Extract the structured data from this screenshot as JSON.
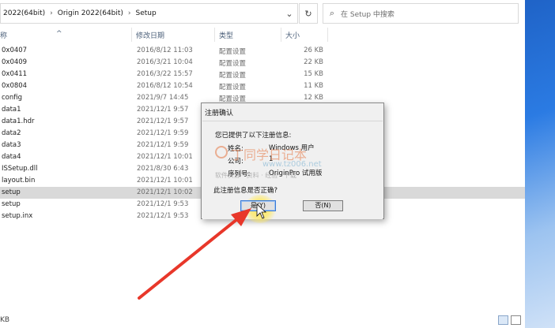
{
  "breadcrumb": [
    "2022(64bit)",
    "Origin 2022(64bit)",
    "Setup"
  ],
  "search": {
    "placeholder": "在 Setup 中搜索"
  },
  "columns": {
    "name": "称",
    "modified": "修改日期",
    "type": "类型",
    "size": "大小"
  },
  "files": [
    {
      "name": "0x0407",
      "date": "2016/8/12 11:03",
      "type": "配置设置",
      "size": "26 KB"
    },
    {
      "name": "0x0409",
      "date": "2016/3/21 10:04",
      "type": "配置设置",
      "size": "22 KB"
    },
    {
      "name": "0x0411",
      "date": "2016/3/22 15:57",
      "type": "配置设置",
      "size": "15 KB"
    },
    {
      "name": "0x0804",
      "date": "2016/8/12 10:54",
      "type": "配置设置",
      "size": "11 KB"
    },
    {
      "name": "config",
      "date": "2021/9/7 14:45",
      "type": "配置设置",
      "size": "12 KB"
    },
    {
      "name": "data1",
      "date": "2021/12/1 9:57",
      "type": "",
      "size": ""
    },
    {
      "name": "data1.hdr",
      "date": "2021/12/1 9:57",
      "type": "",
      "size": ""
    },
    {
      "name": "data2",
      "date": "2021/12/1 9:59",
      "type": "",
      "size": ""
    },
    {
      "name": "data3",
      "date": "2021/12/1 9:59",
      "type": "",
      "size": ""
    },
    {
      "name": "data4",
      "date": "2021/12/1 10:01",
      "type": "",
      "size": ""
    },
    {
      "name": "ISSetup.dll",
      "date": "2021/8/30 6:43",
      "type": "",
      "size": ""
    },
    {
      "name": "layout.bin",
      "date": "2021/12/1 10:01",
      "type": "",
      "size": ""
    },
    {
      "name": "setup",
      "date": "2021/12/1 10:02",
      "type": "",
      "size": ""
    },
    {
      "name": "setup",
      "date": "2021/12/1 9:53",
      "type": "",
      "size": ""
    },
    {
      "name": "setup.inx",
      "date": "2021/12/1 9:53",
      "type": "",
      "size": ""
    }
  ],
  "status": {
    "size_text": "KB"
  },
  "dialog": {
    "title": "注册确认",
    "prompt": "您已提供了以下注册信息:",
    "name_label": "姓名:",
    "name_value": "Windows 用户",
    "company_label": "公司:",
    "company_value": "1",
    "serial_label": "序列号:",
    "serial_value": "OriginPro 试用版",
    "question": "此注册信息是否正确?",
    "yes_label": "是(Y)",
    "no_label": "否(N)"
  },
  "watermark": {
    "title": "丁同学日记本",
    "line2": "www.tz006.net",
    "line3": "软件资源 · 资料 · 经验 · 下载"
  },
  "colors": {
    "accent": "#0078d7",
    "arrow": "#e8372a",
    "highlight": "#ffe85a"
  }
}
